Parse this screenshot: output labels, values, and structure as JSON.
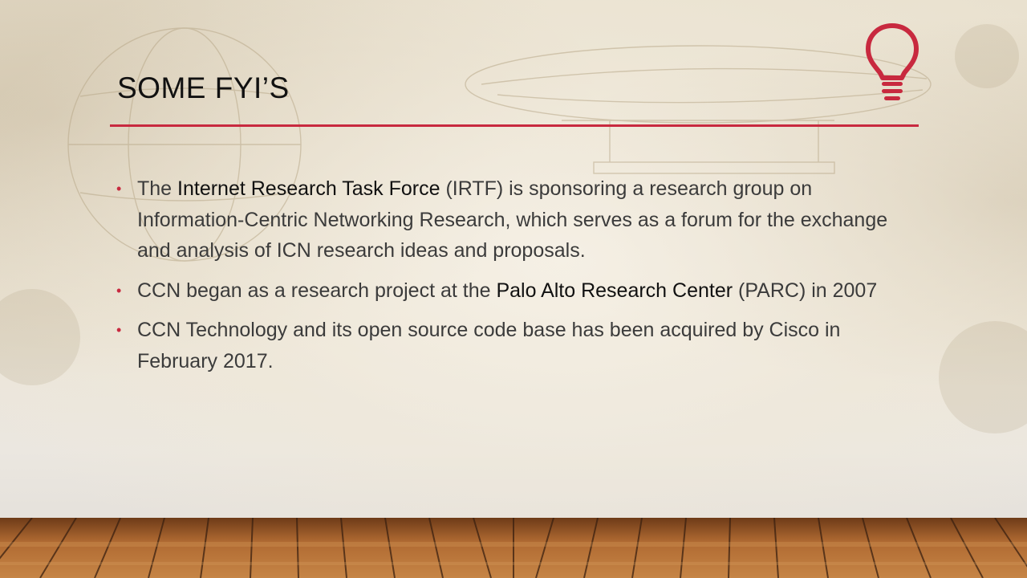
{
  "slide": {
    "title": "SOME FYI’S",
    "accent_color": "#c8293f",
    "icon": "lightbulb-icon",
    "bullets": [
      {
        "pre": "The ",
        "highlight": "Internet Research Task Force",
        "post": " (IRTF) is sponsoring a research group on Information-Centric Networking Research, which serves as a forum for the exchange and analysis of ICN research ideas and proposals."
      },
      {
        "pre": "CCN began as a research project at the ",
        "highlight": "Palo Alto Research Center",
        "post": " (PARC) in 2007"
      },
      {
        "pre": "CCN Technology and its open source code base has been acquired by Cisco in February 2017.",
        "highlight": "",
        "post": ""
      }
    ]
  }
}
